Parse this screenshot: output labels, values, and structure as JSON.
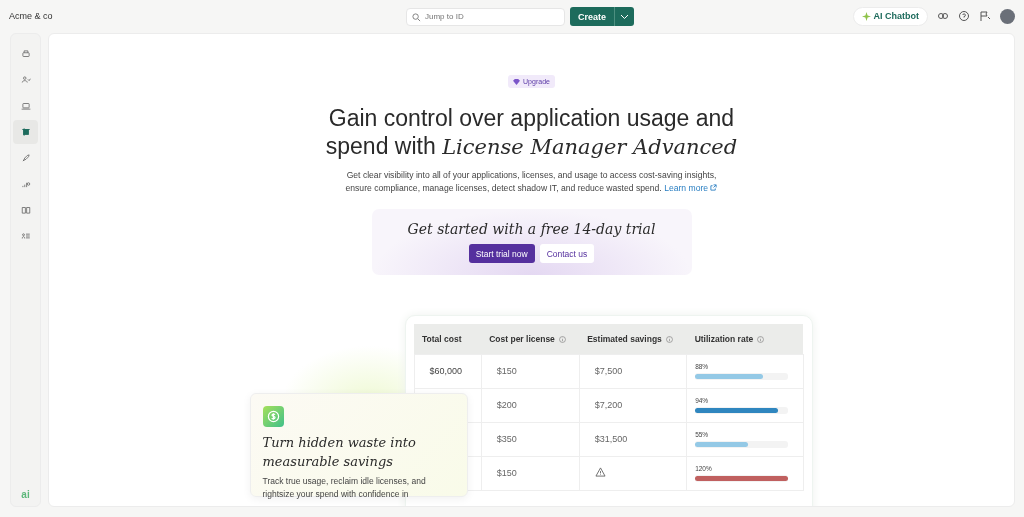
{
  "top_bar": {
    "org_name": "Acme & co",
    "search": {
      "placeholder": "Jump to ID"
    },
    "create_button": "Create",
    "chatbot_button": "AI Chatbot"
  },
  "sidebar": {
    "items": [
      {
        "selected": false
      },
      {
        "selected": false
      },
      {
        "selected": false
      },
      {
        "selected": true
      },
      {
        "selected": false
      },
      {
        "selected": false
      },
      {
        "selected": false
      },
      {
        "selected": false
      }
    ],
    "footer_logo": "ai"
  },
  "hero": {
    "badge": "Upgrade",
    "title": "Gain control over application usage and spend with *License Manager Advanced*",
    "description": "Get clear visibility into all of your applications, licenses, and usage to access cost-saving insights, ensure compliance, manage licenses, detect shadow IT, and reduce wasted spend.",
    "learn_more": "Learn more"
  },
  "trial": {
    "title": "Get started with a free 14-day trial",
    "primary_button": "Start trial now",
    "secondary_button": "Contact us"
  },
  "table": {
    "columns": [
      {
        "label": "Total cost",
        "info": false
      },
      {
        "label": "Cost per license",
        "info": true
      },
      {
        "label": "Estimated savings",
        "info": true
      },
      {
        "label": "Utilization rate",
        "info": true
      }
    ],
    "rows": [
      {
        "total_cost": "$60,000",
        "cost_per_license": "$150",
        "estimated_savings": {
          "kind": "text",
          "text": "$7,500"
        },
        "utilization": {
          "reading": "88%",
          "level": 0.73,
          "color": "#94c9e6"
        }
      },
      {
        "cost_per_license": "$200",
        "estimated_savings": {
          "kind": "text",
          "text": "$7,200"
        },
        "utilization": {
          "reading": "94%",
          "level": 0.89,
          "color": "#2f86bf"
        }
      },
      {
        "cost_per_license": "$350",
        "estimated_savings": {
          "kind": "text",
          "text": "$31,500"
        },
        "utilization": {
          "reading": "55%",
          "level": 0.57,
          "color": "#94c9e6"
        }
      },
      {
        "cost_per_license": "$150",
        "estimated_savings": {
          "kind": "warning"
        },
        "utilization": {
          "reading": "120%",
          "level": 1,
          "color": "#c0605f"
        }
      }
    ]
  },
  "feature_card": {
    "title": "Turn hidden waste into measurable savings",
    "text": "Track true usage, reclaim idle licenses, and rightsize your spend with confidence in"
  }
}
